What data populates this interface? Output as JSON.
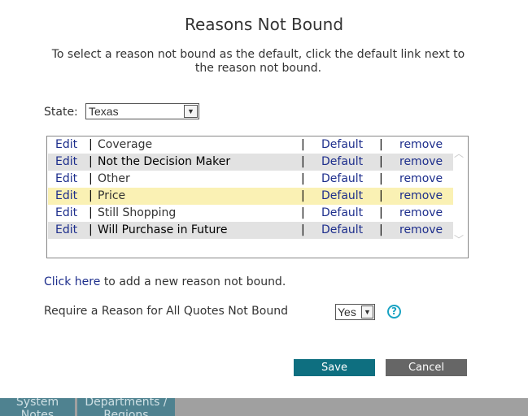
{
  "title": "Reasons Not Bound",
  "subtitle": "To select a reason not bound as the default, click the default link next to the reason not bound.",
  "state": {
    "label": "State:",
    "value": "Texas"
  },
  "reasons": [
    {
      "edit": "Edit",
      "sep": "|",
      "name": "Coverage",
      "default": "Default",
      "remove": "remove"
    },
    {
      "edit": "Edit",
      "sep": "|",
      "name": "Not the Decision Maker",
      "default": "Default",
      "remove": "remove"
    },
    {
      "edit": "Edit",
      "sep": "|",
      "name": "Other",
      "default": "Default",
      "remove": "remove"
    },
    {
      "edit": "Edit",
      "sep": "|",
      "name": "Price",
      "default": "Default",
      "remove": "remove"
    },
    {
      "edit": "Edit",
      "sep": "|",
      "name": "Still Shopping",
      "default": "Default",
      "remove": "remove"
    },
    {
      "edit": "Edit",
      "sep": "|",
      "name": "Will Purchase in Future",
      "default": "Default",
      "remove": "remove"
    }
  ],
  "add": {
    "link": "Click here",
    "text": "to add a new reason not bound."
  },
  "require": {
    "label": "Require a Reason for All Quotes Not Bound",
    "value": "Yes"
  },
  "buttons": {
    "save": "Save",
    "cancel": "Cancel"
  },
  "bottom_tabs": [
    {
      "line1": "System",
      "line2": "Notes"
    },
    {
      "line1": "Departments /",
      "line2": "Regions"
    }
  ],
  "colors": {
    "link": "#1d2e8c",
    "save_bg": "#0e6f80",
    "cancel_bg": "#666666",
    "selected_row": "#faf1b4",
    "alt_row": "#e2e2e2"
  }
}
